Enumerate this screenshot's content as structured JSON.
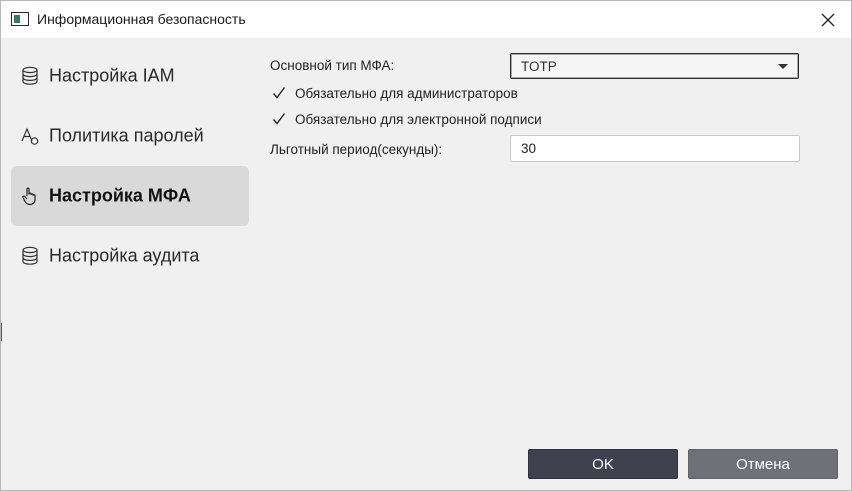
{
  "window": {
    "title": "Информационная безопасность"
  },
  "sidebar": {
    "items": [
      {
        "label": "Настройка IAM",
        "icon": "database-icon",
        "active": false
      },
      {
        "label": "Политика паролей",
        "icon": "text-style-icon",
        "active": false
      },
      {
        "label": "Настройка МФА",
        "icon": "hand-pointer-icon",
        "active": true
      },
      {
        "label": "Настройка аудита",
        "icon": "database-icon",
        "active": false
      }
    ]
  },
  "mfa": {
    "type_label": "Основной тип МФА:",
    "type_value": "TOTP",
    "require_admins_label": "Обязательно для администраторов",
    "require_admins_checked": true,
    "require_esign_label": "Обязательно для электронной подписи",
    "require_esign_checked": true,
    "grace_label": "Льготный период(секунды):",
    "grace_value": "30"
  },
  "footer": {
    "ok_label": "OK",
    "cancel_label": "Отмена"
  },
  "colors": {
    "ok_button": "#3e4150",
    "cancel_button": "#6f7178",
    "active_nav": "#d9d9d9",
    "background": "#f0f0f0"
  }
}
